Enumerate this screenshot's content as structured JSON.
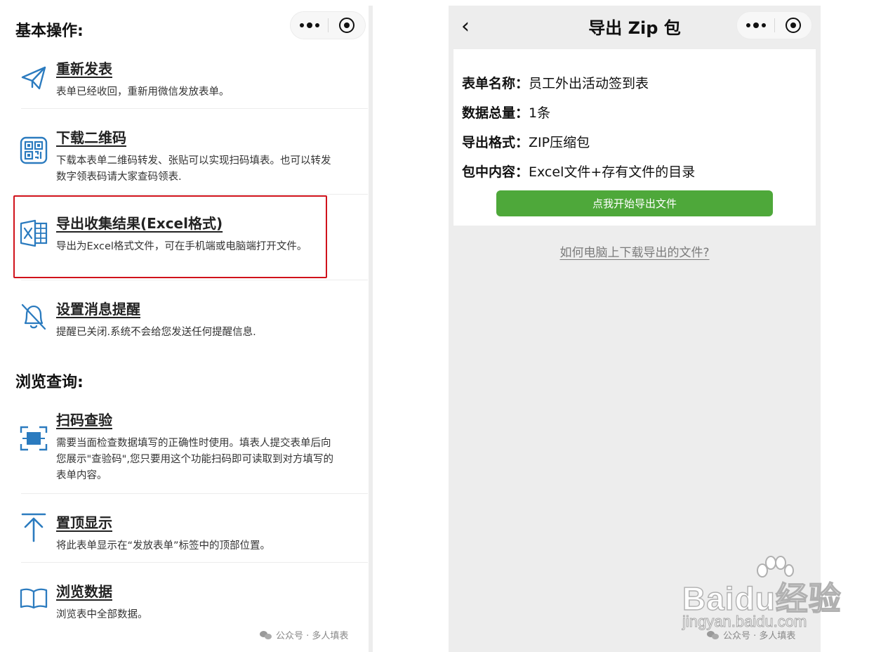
{
  "left": {
    "section_basic": "基本操作:",
    "section_browse": "浏览查询:",
    "items": [
      {
        "title": "重新发表",
        "desc": "表单已经收回，重新用微信发放表单。",
        "icon": "paper-plane-icon"
      },
      {
        "title": "下载二维码",
        "desc": "下载本表单二维码转发、张贴可以实现扫码填表。也可以转发数字领表码请大家查码领表.",
        "icon": "qr-code-icon"
      },
      {
        "title": "导出收集结果(Excel格式)",
        "desc": "导出为Excel格式文件，可在手机端或电脑端打开文件。",
        "icon": "excel-icon"
      },
      {
        "title": "设置消息提醒",
        "desc": "提醒已关闭.系统不会给您发送任何提醒信息.",
        "icon": "bell-off-icon"
      },
      {
        "title": "扫码查验",
        "desc": "需要当面检查数据填写的正确性时使用。填表人提交表单后向您展示\"查验码\",您只要用这个功能扫码即可读取到对方填写的表单内容。",
        "icon": "scan-icon"
      },
      {
        "title": "置顶显示",
        "desc": "将此表单显示在“发放表单”标签中的顶部位置。",
        "icon": "pin-top-icon"
      },
      {
        "title": "浏览数据",
        "desc": "浏览表中全部数据。",
        "icon": "book-icon"
      }
    ],
    "watermark": "公众号 · 多人填表"
  },
  "right": {
    "title": "导出 Zip 包",
    "back_glyph": "‹",
    "fields": [
      {
        "key": "表单名称：",
        "value": "员工外出活动签到表"
      },
      {
        "key": "数据总量：",
        "value": "1条"
      },
      {
        "key": "导出格式：",
        "value": "ZIP压缩包"
      },
      {
        "key": "包中内容：",
        "value": "Excel文件+存有文件的目录"
      }
    ],
    "export_button": "点我开始导出文件",
    "help_link": "如何电脑上下载导出的文件?",
    "watermark": "公众号 · 多人填表"
  },
  "baidu": {
    "brand": "Baidu经验",
    "url": "jingyan.baidu.com"
  },
  "colors": {
    "accent_blue": "#2b7bbf",
    "button_green": "#4ea83a",
    "highlight_red": "#d0121b"
  }
}
